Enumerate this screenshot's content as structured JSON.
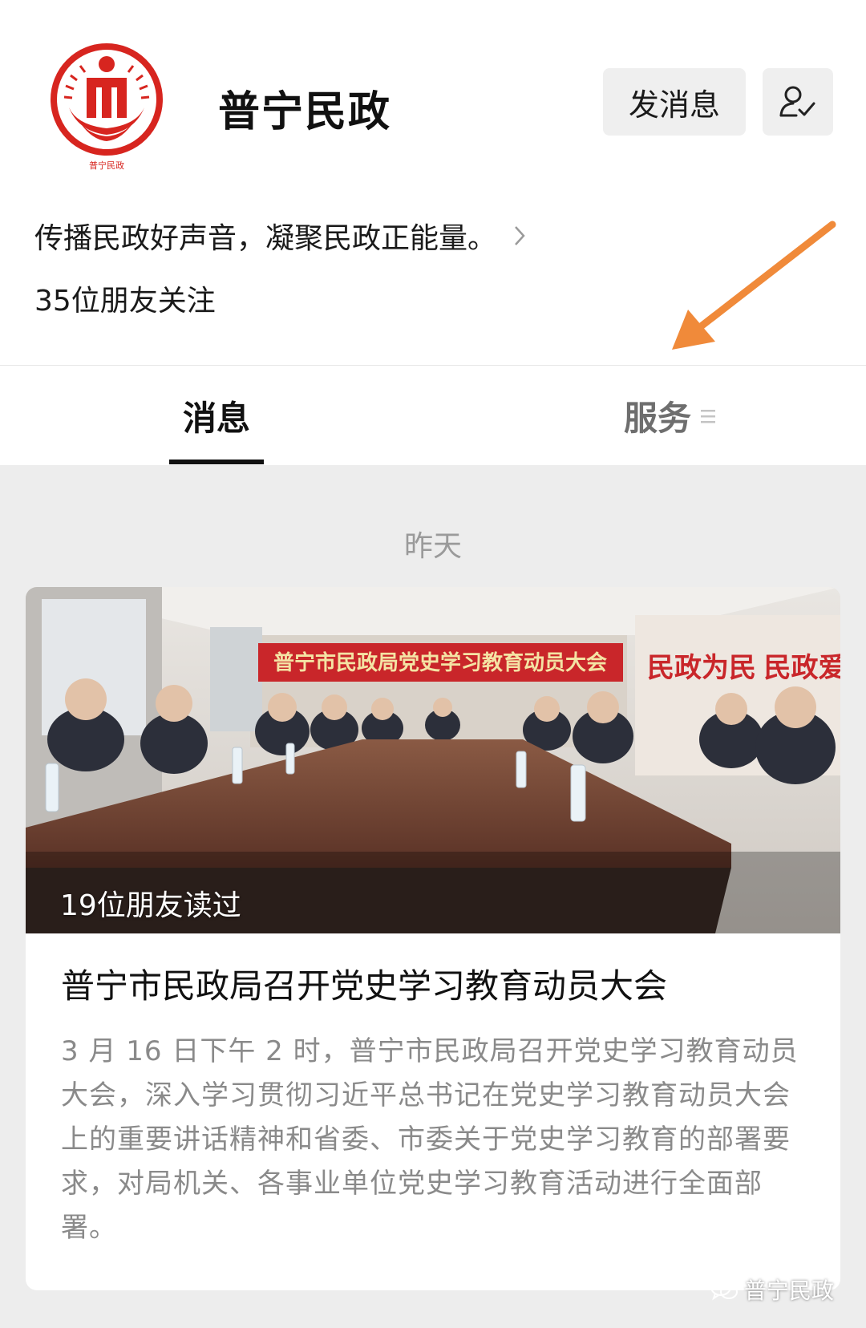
{
  "account": {
    "name": "普宁民政",
    "logo_caption": "普宁民政",
    "description": "传播民政好声音，凝聚民政正能量。",
    "followers": "35位朋友关注"
  },
  "actions": {
    "message_button": "发消息",
    "follow_icon": "user-check-icon"
  },
  "tabs": [
    {
      "label": "消息",
      "active": true
    },
    {
      "label": "服务",
      "active": false,
      "icon": "menu-icon"
    }
  ],
  "feed": {
    "date_label": "昨天",
    "article": {
      "read_count": "19位朋友读过",
      "image_banner": "普宁市民政局党史学习教育动员大会",
      "image_wall_text": "民政为民 民政爱",
      "title": "普宁市民政局召开党史学习教育动员大会",
      "summary": "3 月 16 日下午 2 时，普宁市民政局召开党史学习教育动员大会，深入学习贯彻习近平总书记在党史学习教育动员大会上的重要讲话精神和省委、市委关于党史学习教育的部署要求，对局机关、各事业单位党史学习教育活动进行全面部署。"
    }
  },
  "watermark": "普宁民政",
  "colors": {
    "logo_red": "#d7251f",
    "annotation_arrow": "#f08a3a",
    "feed_background": "#ededed"
  }
}
